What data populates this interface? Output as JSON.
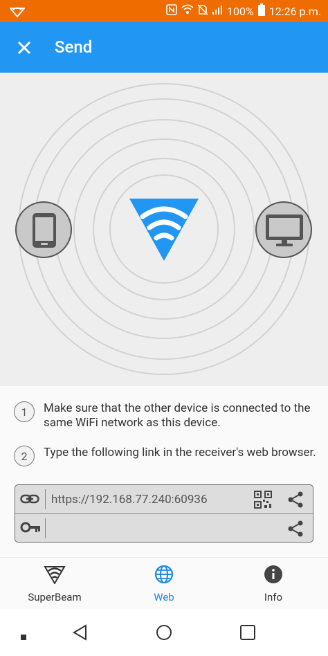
{
  "status_bar": {
    "battery": "100%",
    "time": "12:26 p.m."
  },
  "app_bar": {
    "title": "Send"
  },
  "instructions": {
    "step1": {
      "number": "1",
      "text": "Make sure that the other device is connected to the same WiFi network as this device."
    },
    "step2": {
      "number": "2",
      "text": "Type the following link in the receiver's web browser."
    }
  },
  "link_box": {
    "url": "https://192.168.77.240:60936",
    "key": ""
  },
  "bottom_nav": [
    {
      "label": "SuperBeam",
      "icon": "wifi-logo-icon",
      "active": false
    },
    {
      "label": "Web",
      "icon": "globe-icon",
      "active": true
    },
    {
      "label": "Info",
      "icon": "info-icon",
      "active": false
    }
  ],
  "colors": {
    "status_bar": "#ef6c00",
    "app_bar": "#2196f3",
    "accent": "#1e88e5",
    "logo": "#2196f3"
  }
}
